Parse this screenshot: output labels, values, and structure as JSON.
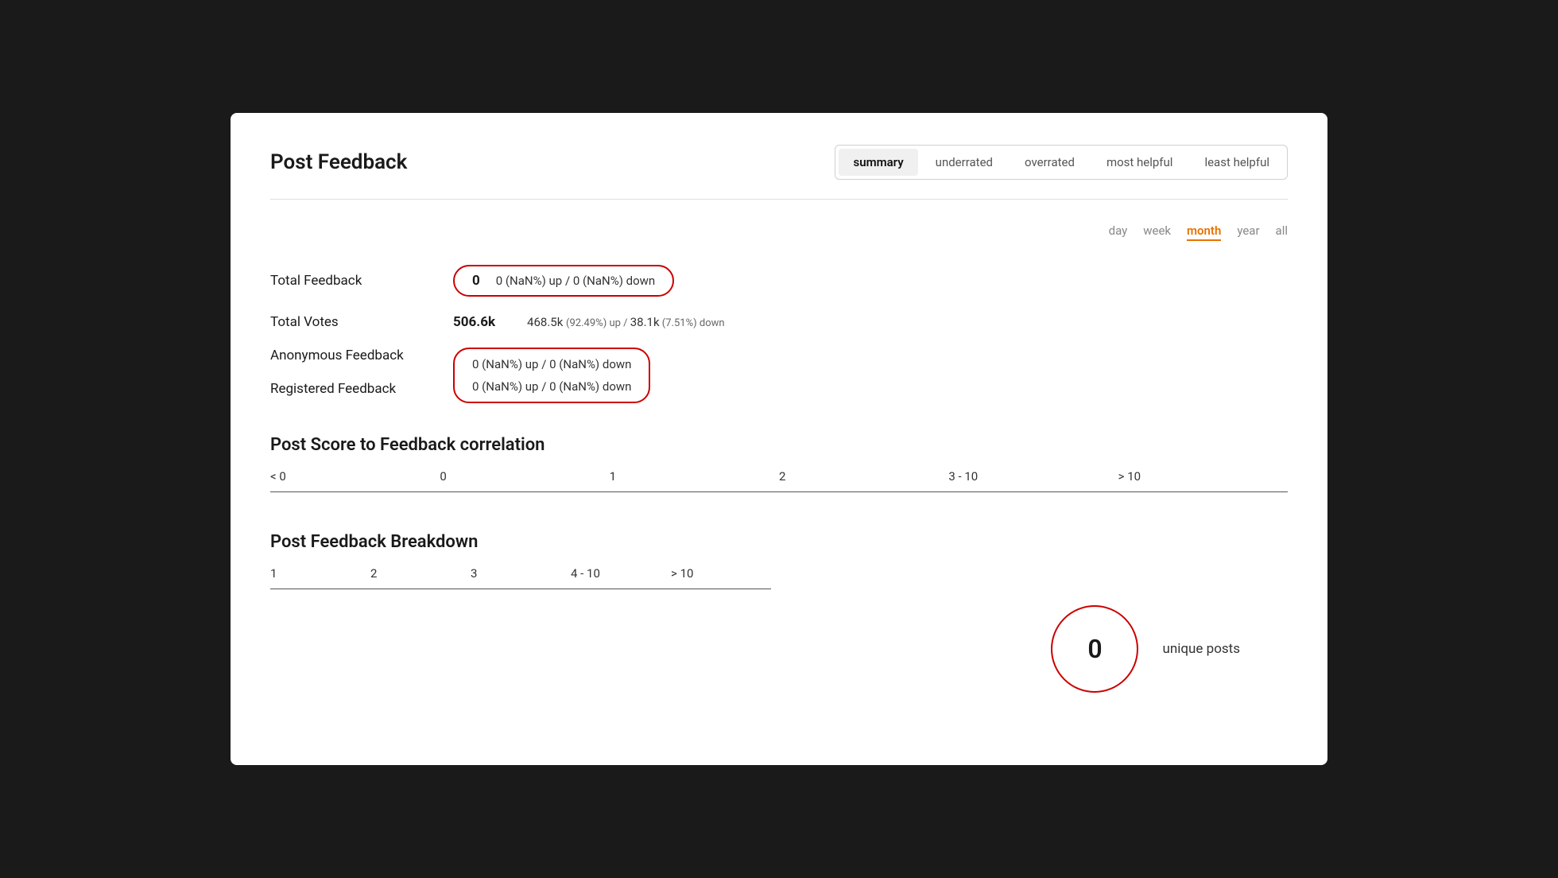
{
  "page": {
    "title": "Post Feedback"
  },
  "tabs": [
    {
      "id": "summary",
      "label": "summary",
      "active": true
    },
    {
      "id": "underrated",
      "label": "underrated",
      "active": false
    },
    {
      "id": "overrated",
      "label": "overrated",
      "active": false
    },
    {
      "id": "most-helpful",
      "label": "most helpful",
      "active": false
    },
    {
      "id": "least-helpful",
      "label": "least helpful",
      "active": false
    }
  ],
  "time_filters": [
    {
      "id": "day",
      "label": "day",
      "active": false
    },
    {
      "id": "week",
      "label": "week",
      "active": false
    },
    {
      "id": "month",
      "label": "month",
      "active": true
    },
    {
      "id": "year",
      "label": "year",
      "active": false
    },
    {
      "id": "all",
      "label": "all",
      "active": false
    }
  ],
  "stats": {
    "total_feedback": {
      "label": "Total Feedback",
      "value": "0",
      "detail": "0 (NaN%) up / 0 (NaN%) down"
    },
    "total_votes": {
      "label": "Total Votes",
      "value": "506.6k",
      "up_value": "468.5k",
      "up_pct": "92.49%",
      "down_value": "38.1k",
      "down_pct": "7.51%"
    },
    "anonymous_feedback": {
      "label": "Anonymous Feedback",
      "detail": "0 (NaN%) up / 0 (NaN%) down"
    },
    "registered_feedback": {
      "label": "Registered Feedback",
      "detail": "0 (NaN%) up / 0 (NaN%) down"
    }
  },
  "score_correlation": {
    "title": "Post Score to Feedback correlation",
    "columns": [
      "< 0",
      "0",
      "1",
      "2",
      "3 - 10",
      "> 10"
    ]
  },
  "breakdown": {
    "title": "Post Feedback Breakdown",
    "columns": [
      "1",
      "2",
      "3",
      "4 - 10",
      "> 10"
    ]
  },
  "unique_posts": {
    "value": "0",
    "label": "unique posts"
  }
}
